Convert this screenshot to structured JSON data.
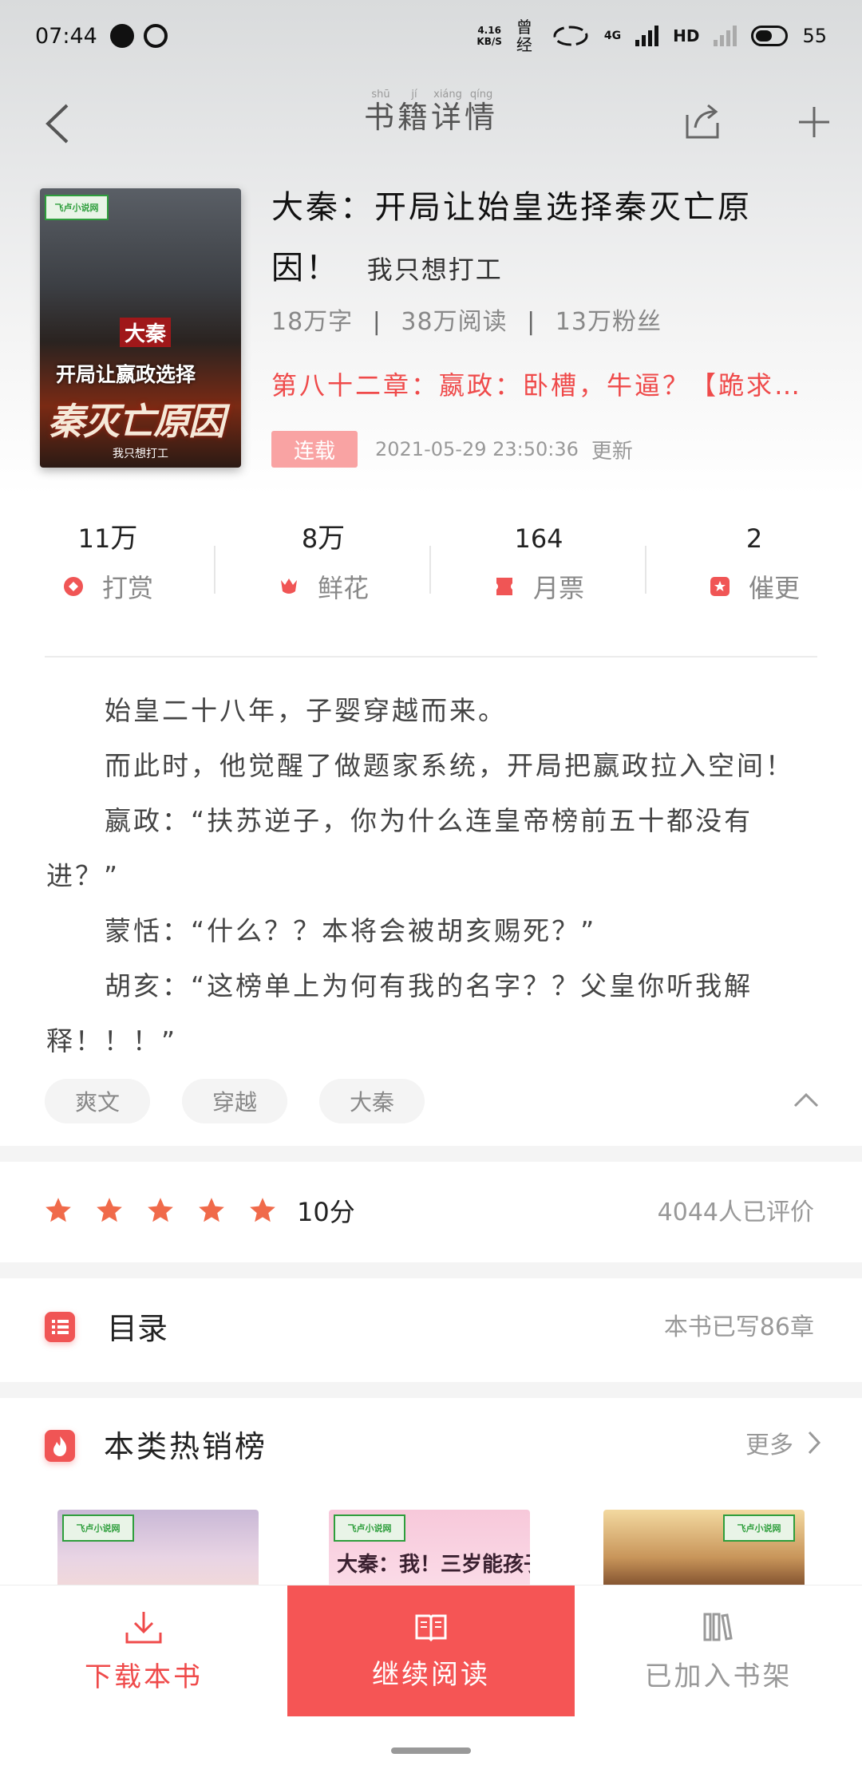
{
  "status_bar": {
    "time": "07:44",
    "net_speed_value": "4.16",
    "net_speed_unit": "KB/S",
    "carrier": "曾经",
    "network": "4G",
    "hd": "HD",
    "battery": "55"
  },
  "nav": {
    "title": "书籍详情",
    "title_pinyin": [
      "shū",
      "jí",
      "xiáng",
      "qíng"
    ]
  },
  "book": {
    "cover_logo": "飞卢小说网",
    "cover_line1": "大秦",
    "cover_line2": "开局让嬴政选择",
    "cover_line3": "秦灭亡原因",
    "cover_author": "我只想打工",
    "title_line1": "大秦：开局让始皇选择秦灭亡原",
    "title_line2": "因！",
    "author": "我只想打工",
    "word_count": "18万字",
    "reads": "38万阅读",
    "fans": "13万粉丝",
    "latest_chapter": "第八十二章：嬴政：卧槽，牛逼？【跪求…",
    "status": "连载",
    "update_time": "2021-05-29 23:50:36",
    "update_label": "更新"
  },
  "stats": [
    {
      "value": "11",
      "unit": "万",
      "label": "打赏",
      "color": "#f05555"
    },
    {
      "value": "8",
      "unit": "万",
      "label": "鲜花",
      "color": "#f05555"
    },
    {
      "value": "164",
      "unit": "",
      "label": "月票",
      "color": "#f05555"
    },
    {
      "value": "2",
      "unit": "",
      "label": "催更",
      "color": "#f05555"
    }
  ],
  "intro": [
    "始皇二十八年，子婴穿越而来。",
    "而此时，他觉醒了做题家系统，开局把嬴政拉入空间！",
    "嬴政：“扶苏逆子，你为什么连皇帝榜前五十都没有进？”",
    "蒙恬：“什么？？本将会被胡亥赐死？”",
    "胡亥：“这榜单上为何有我的名字？？父皇你听我解释！！！”"
  ],
  "tags": [
    "爽文",
    "穿越",
    "大秦"
  ],
  "rating": {
    "stars": 5,
    "score": "10分",
    "raters": "4044人已评价",
    "star_color": "#f06a4a"
  },
  "toc": {
    "title": "目录",
    "count": "本书已写86章"
  },
  "hot": {
    "title": "本类热销榜",
    "more": "更多",
    "covers": [
      {
        "logo": "飞卢小说网"
      },
      {
        "logo": "飞卢小说网",
        "text": "大秦：我！三岁能孩子"
      },
      {
        "logo": "飞卢小说网"
      }
    ]
  },
  "bottom": {
    "download": "下载本书",
    "continue": "继续阅读",
    "shelf": "已加入书架",
    "accent": "#f55555"
  }
}
